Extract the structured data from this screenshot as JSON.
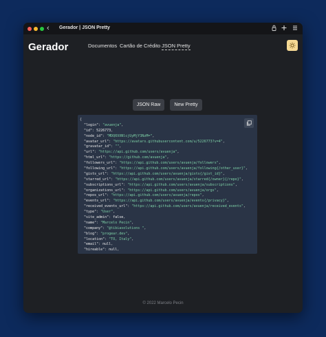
{
  "window": {
    "title": "Gerador | JSON Pretty",
    "back_glyph": "‹",
    "icons": [
      "lock-icon",
      "plus-icon",
      "menu-icon"
    ]
  },
  "header": {
    "brand": "Gerador",
    "nav": [
      "Documentos",
      "Cartão de Crédito",
      "JSON Pretty"
    ],
    "active_nav": "JSON Pretty",
    "theme_icon": "sun-icon"
  },
  "colors": {
    "page_bg": "#0d2a5c",
    "app_bg": "#1e2024",
    "code_bg": "#2a3446",
    "string": "#7fd3a8",
    "theme_button": "#f5d994"
  },
  "actions": {
    "json_raw": "JSON Raw",
    "new_pretty": "New Pretty"
  },
  "json_lines": [
    {
      "k": "login",
      "v": "\"avuenja\"",
      "t": "s"
    },
    {
      "k": "id",
      "v": "5226773",
      "t": "n"
    },
    {
      "k": "node_id",
      "v": "\"MDQ6VXNlcjUyMjY3NzM=\"",
      "t": "s"
    },
    {
      "k": "avatar_url",
      "v": "\"https://avatars.githubusercontent.com/u/5226773?v=4\"",
      "t": "s"
    },
    {
      "k": "gravatar_id",
      "v": "\"\"",
      "t": "s"
    },
    {
      "k": "url",
      "v": "\"https://api.github.com/users/avuenja\"",
      "t": "s"
    },
    {
      "k": "html_url",
      "v": "\"https://github.com/avuenja\"",
      "t": "s"
    },
    {
      "k": "followers_url",
      "v": "\"https://api.github.com/users/avuenja/followers\"",
      "t": "s"
    },
    {
      "k": "following_url",
      "v": "\"https://api.github.com/users/avuenja/following{/other_user}\"",
      "t": "s"
    },
    {
      "k": "gists_url",
      "v": "\"https://api.github.com/users/avuenja/gists{/gist_id}\"",
      "t": "s"
    },
    {
      "k": "starred_url",
      "v": "\"https://api.github.com/users/avuenja/starred{/owner}{/repo}\"",
      "t": "s"
    },
    {
      "k": "subscriptions_url",
      "v": "\"https://api.github.com/users/avuenja/subscriptions\"",
      "t": "s"
    },
    {
      "k": "organizations_url",
      "v": "\"https://api.github.com/users/avuenja/orgs\"",
      "t": "s"
    },
    {
      "k": "repos_url",
      "v": "\"https://api.github.com/users/avuenja/repos\"",
      "t": "s"
    },
    {
      "k": "events_url",
      "v": "\"https://api.github.com/users/avuenja/events{/privacy}\"",
      "t": "s"
    },
    {
      "k": "received_events_url",
      "v": "\"https://api.github.com/users/avuenja/received_events\"",
      "t": "s"
    },
    {
      "k": "type",
      "v": "\"User\"",
      "t": "s"
    },
    {
      "k": "site_admin",
      "v": "false",
      "t": "n"
    },
    {
      "k": "name",
      "v": "\"Marcelo Pecin\"",
      "t": "s"
    },
    {
      "k": "company",
      "v": "\"@tibiasolutions \"",
      "t": "s"
    },
    {
      "k": "blog",
      "v": "\"progear.dev\"",
      "t": "s"
    },
    {
      "k": "location",
      "v": "\"TO, Italy\"",
      "t": "s"
    },
    {
      "k": "email",
      "v": "null",
      "t": "n"
    },
    {
      "k": "hireable",
      "v": "null",
      "t": "n"
    }
  ],
  "footer": "© 2022 Marcelo Pecin"
}
